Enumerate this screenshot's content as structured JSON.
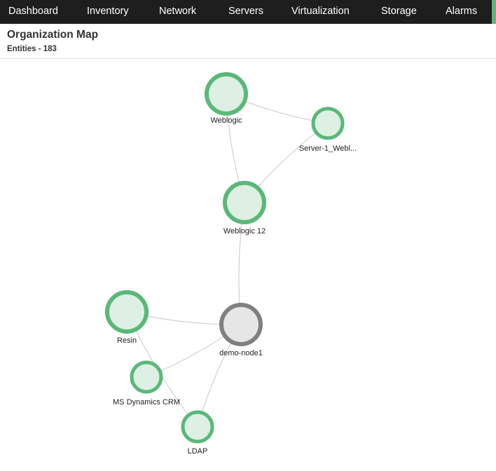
{
  "nav": {
    "items": [
      {
        "label": "Dashboard"
      },
      {
        "label": "Inventory"
      },
      {
        "label": "Network"
      },
      {
        "label": "Servers"
      },
      {
        "label": "Virtualization"
      },
      {
        "label": "Storage"
      },
      {
        "label": "Alarms"
      }
    ],
    "accent_color": "#5ab878"
  },
  "header": {
    "title": "Organization Map",
    "entities": "Entities - 183"
  },
  "map": {
    "status_colors": {
      "up": {
        "stroke": "#5ab878",
        "fill": "#ddf0e3"
      },
      "unknown": {
        "stroke": "#808080",
        "fill": "#e6e6e6"
      }
    },
    "nodes": [
      {
        "id": "weblogic",
        "label": "Weblogic",
        "status": "up"
      },
      {
        "id": "server1",
        "label": "Server-1_Webl...",
        "status": "up"
      },
      {
        "id": "weblogic12",
        "label": "Weblogic 12",
        "status": "up"
      },
      {
        "id": "resin",
        "label": "Resin",
        "status": "up"
      },
      {
        "id": "demonode1",
        "label": "demo-node1",
        "status": "unknown"
      },
      {
        "id": "msdynamics",
        "label": "MS Dynamics CRM",
        "status": "up"
      },
      {
        "id": "ldap",
        "label": "LDAP",
        "status": "up"
      }
    ],
    "edges": [
      [
        "weblogic",
        "server1"
      ],
      [
        "weblogic",
        "weblogic12"
      ],
      [
        "server1",
        "weblogic12"
      ],
      [
        "weblogic12",
        "demonode1"
      ],
      [
        "resin",
        "demonode1"
      ],
      [
        "resin",
        "ldap"
      ],
      [
        "msdynamics",
        "demonode1"
      ],
      [
        "demonode1",
        "ldap"
      ]
    ]
  }
}
